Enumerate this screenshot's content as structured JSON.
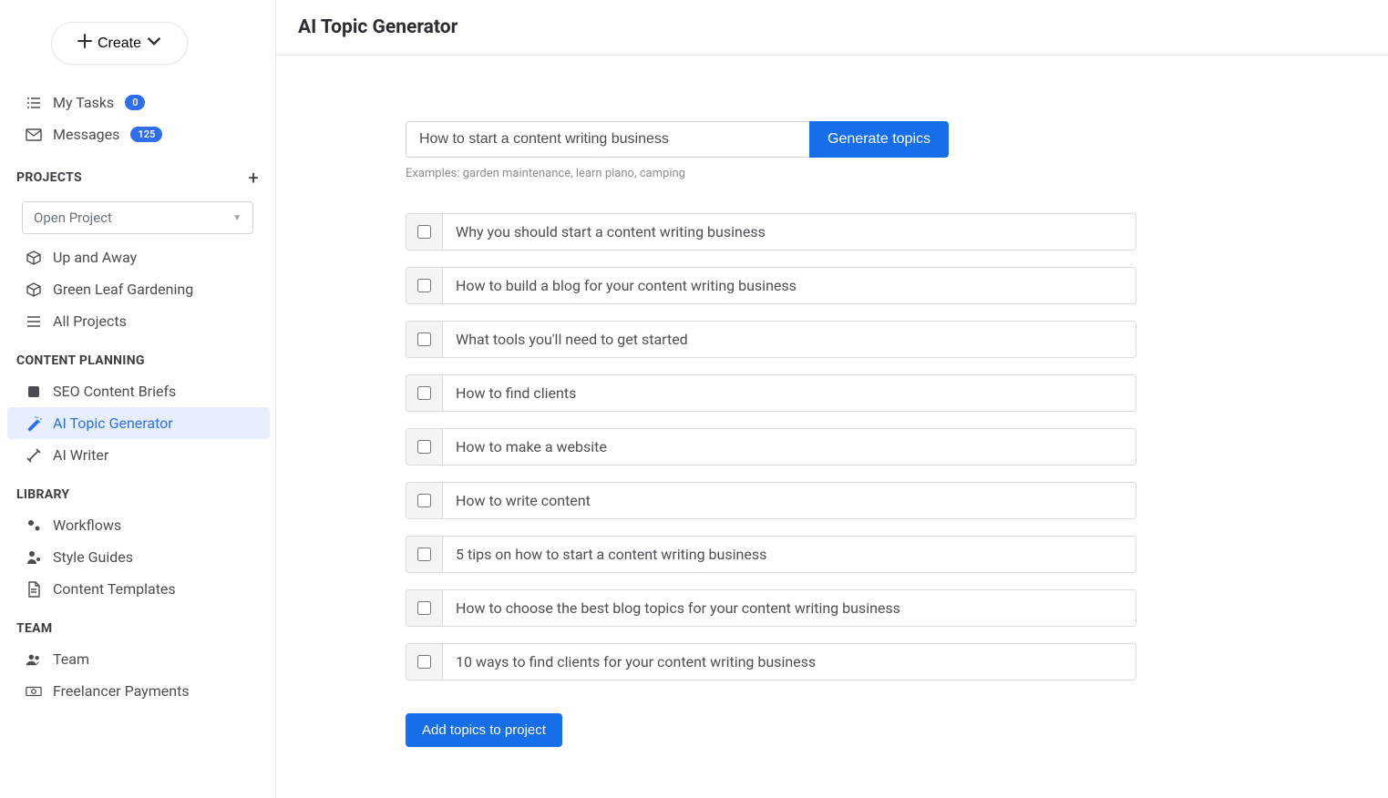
{
  "header": {
    "title": "AI Topic Generator"
  },
  "create_button": {
    "label": "Create"
  },
  "nav_top": [
    {
      "icon": "tasks",
      "label": "My Tasks",
      "badge": "0"
    },
    {
      "icon": "envelope",
      "label": "Messages",
      "badge": "125"
    }
  ],
  "sections": {
    "projects": {
      "title": "PROJECTS",
      "select_placeholder": "Open Project",
      "items": [
        {
          "icon": "cube",
          "label": "Up and Away"
        },
        {
          "icon": "cube",
          "label": "Green Leaf Gardening"
        },
        {
          "icon": "list",
          "label": "All Projects"
        }
      ]
    },
    "content_planning": {
      "title": "CONTENT PLANNING",
      "items": [
        {
          "icon": "brief",
          "label": "SEO Content Briefs",
          "active": false
        },
        {
          "icon": "wand",
          "label": "AI Topic Generator",
          "active": true
        },
        {
          "icon": "magic",
          "label": "AI Writer",
          "active": false
        }
      ]
    },
    "library": {
      "title": "LIBRARY",
      "items": [
        {
          "icon": "gears",
          "label": "Workflows"
        },
        {
          "icon": "person-gear",
          "label": "Style Guides"
        },
        {
          "icon": "doc",
          "label": "Content Templates"
        }
      ]
    },
    "team": {
      "title": "TEAM",
      "items": [
        {
          "icon": "people",
          "label": "Team"
        },
        {
          "icon": "money",
          "label": "Freelancer Payments"
        }
      ]
    }
  },
  "generator": {
    "input_value": "How to start a content writing business",
    "generate_label": "Generate topics",
    "examples_text": "Examples: garden maintenance, learn piano, camping",
    "topics": [
      "Why you should start a content writing business",
      "How to build a blog for your content writing business",
      "What tools you'll need to get started",
      "How to find clients",
      "How to make a website",
      "How to write content",
      "5 tips on how to start a content writing business",
      "How to choose the best blog topics for your content writing business",
      "10 ways to find clients for your content writing business"
    ],
    "add_label": "Add topics to project"
  }
}
